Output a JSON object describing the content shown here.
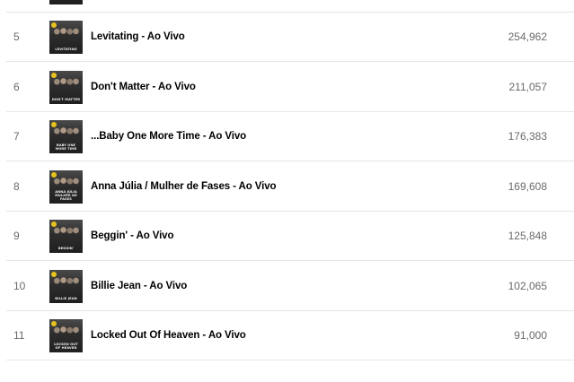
{
  "tracks": [
    {
      "rank": "5",
      "title": "Levitating - Ao Vivo",
      "plays": "254,962",
      "art_caption": "LEVITATING"
    },
    {
      "rank": "6",
      "title": "Don't Matter - Ao Vivo",
      "plays": "211,057",
      "art_caption": "DON'T MATTER"
    },
    {
      "rank": "7",
      "title": "...Baby One More Time - Ao Vivo",
      "plays": "176,383",
      "art_caption": "BABY ONE MORE TIME"
    },
    {
      "rank": "8",
      "title": "Anna Júlia / Mulher de Fases - Ao Vivo",
      "plays": "169,608",
      "art_caption": "ANNA JÚLIA MULHER DE FASES"
    },
    {
      "rank": "9",
      "title": "Beggin' - Ao Vivo",
      "plays": "125,848",
      "art_caption": "BEGGIN'"
    },
    {
      "rank": "10",
      "title": "Billie Jean - Ao Vivo",
      "plays": "102,065",
      "art_caption": "BILLIE JEAN"
    },
    {
      "rank": "11",
      "title": "Locked Out Of Heaven - Ao Vivo",
      "plays": "91,000",
      "art_caption": "LOCKED OUT OF HEAVEN"
    }
  ]
}
